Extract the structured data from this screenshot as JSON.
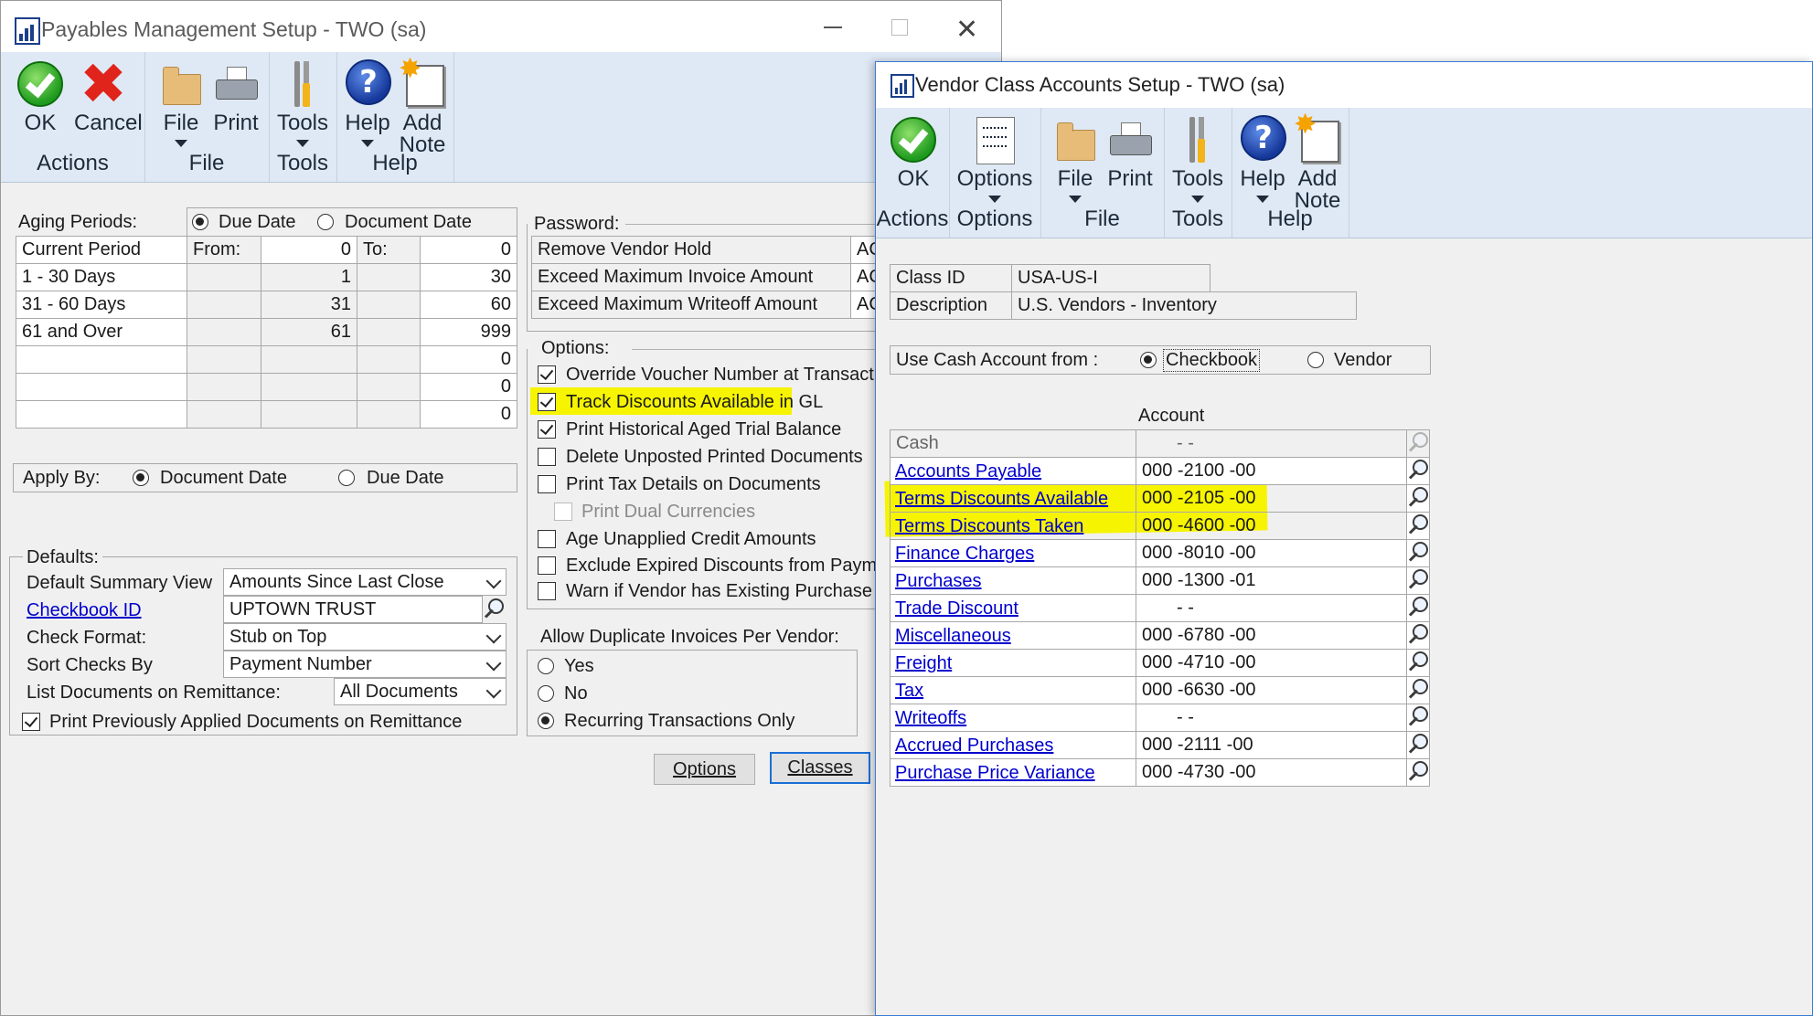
{
  "payables": {
    "title": "Payables Management Setup  -  TWO (sa)",
    "ribbon": {
      "ok": "OK",
      "cancel": "Cancel",
      "file": "File",
      "print": "Print",
      "tools": "Tools",
      "help": "Help",
      "add": "Add",
      "note": "Note",
      "groups": {
        "actions": "Actions",
        "file": "File",
        "tools": "Tools",
        "help": "Help"
      }
    },
    "aging": {
      "label": "Aging Periods:",
      "due_date": "Due Date",
      "document_date": "Document Date",
      "selected": "Due Date",
      "from_label": "From:",
      "to_label": "To:",
      "rows": [
        {
          "name": "Current Period",
          "from": "0",
          "to": "0"
        },
        {
          "name": "1 - 30 Days",
          "from": "1",
          "to": "30"
        },
        {
          "name": "31 - 60 Days",
          "from": "31",
          "to": "60"
        },
        {
          "name": "61 and Over",
          "from": "61",
          "to": "999"
        },
        {
          "name": "",
          "from": "",
          "to": "0"
        },
        {
          "name": "",
          "from": "",
          "to": "0"
        },
        {
          "name": "",
          "from": "",
          "to": "0"
        }
      ]
    },
    "apply_by": {
      "label": "Apply By:",
      "document_date": "Document Date",
      "due_date": "Due Date",
      "selected": "Document Date"
    },
    "defaults": {
      "label": "Defaults:",
      "summary_view_label": "Default Summary View",
      "summary_view_value": "Amounts Since Last Close",
      "checkbook_label": "Checkbook ID",
      "checkbook_value": "UPTOWN TRUST",
      "check_format_label": "Check Format:",
      "check_format_value": "Stub on Top",
      "sort_checks_label": "Sort Checks By",
      "sort_checks_value": "Payment Number",
      "list_docs_label": "List Documents on Remittance:",
      "list_docs_value": "All Documents",
      "print_prev_label": "Print Previously Applied Documents on Remittance"
    },
    "password": {
      "label": "Password:",
      "rows": [
        {
          "label": "Remove Vendor Hold",
          "value": "AC"
        },
        {
          "label": "Exceed Maximum Invoice Amount",
          "value": "AC"
        },
        {
          "label": "Exceed Maximum Writeoff Amount",
          "value": "AC"
        }
      ]
    },
    "options": {
      "label": "Options:",
      "items": [
        {
          "label": "Override Voucher Number at Transaction Entr",
          "checked": true
        },
        {
          "label": "Track Discounts  Available in GL",
          "checked": true
        },
        {
          "label": "Print Historical  Aged Trial Balance",
          "checked": true
        },
        {
          "label": "Delete Unposted Printed Documents",
          "checked": false
        },
        {
          "label": "Print Tax Details on Documents",
          "checked": false
        },
        {
          "label": "Print Dual Currencies",
          "checked": false
        },
        {
          "label": "Age Unapplied Credit Amounts",
          "checked": false
        },
        {
          "label": "Exclude Expired Discounts from Payments",
          "checked": false
        },
        {
          "label": "Warn if Vendor has Existing Purchase Order",
          "checked": false
        }
      ]
    },
    "duplicates": {
      "label": "Allow Duplicate Invoices Per Vendor:",
      "yes": "Yes",
      "no": "No",
      "recurring": "Recurring Transactions Only",
      "selected": "Recurring Transactions Only"
    },
    "buttons": {
      "options": "Options",
      "classes": "Classes"
    }
  },
  "vendor_class": {
    "title": "Vendor Class Accounts Setup  -  TWO (sa)",
    "ribbon": {
      "ok": "OK",
      "options": "Options",
      "file": "File",
      "print": "Print",
      "tools": "Tools",
      "help": "Help",
      "add": "Add",
      "note": "Note",
      "groups": {
        "actions": "Actions",
        "options": "Options",
        "file": "File",
        "tools": "Tools",
        "help": "Help"
      }
    },
    "class_id_label": "Class ID",
    "class_id_value": "USA-US-I",
    "description_label": "Description",
    "description_value": "U.S. Vendors - Inventory",
    "cash_from_label": "Use Cash Account from :",
    "checkbook": "Checkbook",
    "vendor": "Vendor",
    "cash_selected": "Checkbook",
    "account_header": "Account",
    "cash_label": "Cash",
    "cash_value": "-         -",
    "accounts": [
      {
        "label": "Accounts Payable",
        "value": "000 -2100 -00"
      },
      {
        "label": "Terms Discounts Available",
        "value": "000 -2105 -00"
      },
      {
        "label": "Terms Discounts Taken",
        "value": "000 -4600 -00"
      },
      {
        "label": "Finance Charges",
        "value": "000 -8010 -00"
      },
      {
        "label": "Purchases",
        "value": "000 -1300 -01"
      },
      {
        "label": "Trade Discount",
        "value": "-         -"
      },
      {
        "label": "Miscellaneous",
        "value": "000 -6780 -00"
      },
      {
        "label": "Freight",
        "value": "000 -4710 -00"
      },
      {
        "label": "Tax",
        "value": "000 -6630 -00"
      },
      {
        "label": "Writeoffs",
        "value": "-         -"
      },
      {
        "label": "Accrued Purchases",
        "value": "000 -2111 -00"
      },
      {
        "label": "Purchase Price Variance",
        "value": "000 -4730 -00"
      }
    ]
  }
}
